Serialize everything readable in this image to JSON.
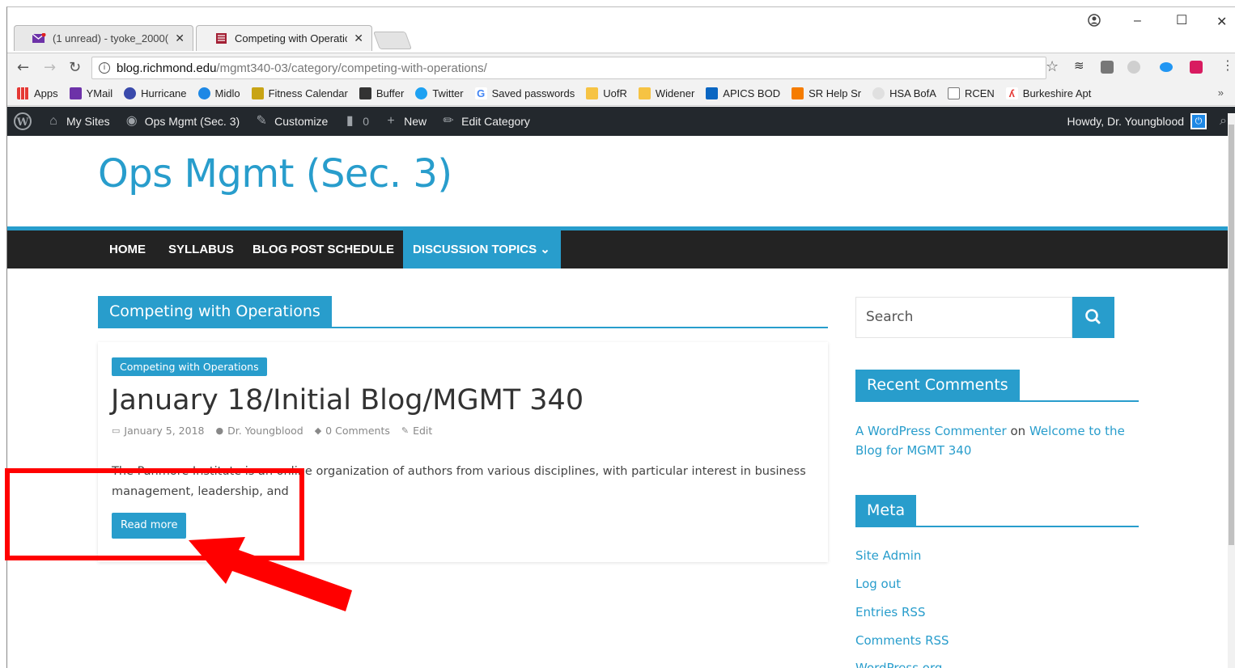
{
  "browser": {
    "tabs": [
      {
        "title": "(1 unread) - tyoke_2000(",
        "close": "✕"
      },
      {
        "title": "Competing with Operatic",
        "close": "✕"
      }
    ],
    "url_host": "blog.richmond.edu",
    "url_path": "/mgmt340-03/category/competing-with-operations/",
    "bookmarks": [
      "Apps",
      "YMail",
      "Hurricane",
      "Midlo",
      "Fitness Calendar",
      "Buffer",
      "Twitter",
      "Saved passwords",
      "UofR",
      "Widener",
      "APICS BOD",
      "SR Help Sr",
      "HSA BofA",
      "RCEN",
      "Burkeshire Apt"
    ],
    "bookmarks_more": "»"
  },
  "adminbar": {
    "my_sites": "My Sites",
    "site": "Ops Mgmt (Sec. 3)",
    "customize": "Customize",
    "comments_count": "0",
    "new": "New",
    "edit_category": "Edit Category",
    "howdy": "Howdy, Dr. Youngblood"
  },
  "site": {
    "title": "Ops Mgmt (Sec. 3)",
    "nav": [
      "HOME",
      "SYLLABUS",
      "BLOG POST SCHEDULE",
      "DISCUSSION TOPICS ⌄"
    ]
  },
  "archive": {
    "heading": "Competing with Operations"
  },
  "post": {
    "category": "Competing with Operations",
    "title": "January 18/Initial Blog/MGMT 340",
    "date": "January 5, 2018",
    "author": "Dr. Youngblood",
    "comments": "0 Comments",
    "edit": "Edit",
    "excerpt": "The Panmore Institute is an online organization of authors from various disciplines, with particular interest in business management, leadership, and",
    "read_more": "Read more"
  },
  "sidebar": {
    "search_placeholder": "Search",
    "recent_comments_title": "Recent Comments",
    "comment_author": "A WordPress Commenter",
    "comment_on": "on",
    "comment_post": "Welcome to the Blog for MGMT 340",
    "meta_title": "Meta",
    "meta_links": [
      "Site Admin",
      "Log out",
      "Entries RSS",
      "Comments RSS",
      "WordPress.org"
    ]
  },
  "colors": {
    "accent": "#289dcc",
    "nav_bg": "#232323",
    "adminbar_bg": "#23282d",
    "annotation": "#ff0000"
  }
}
